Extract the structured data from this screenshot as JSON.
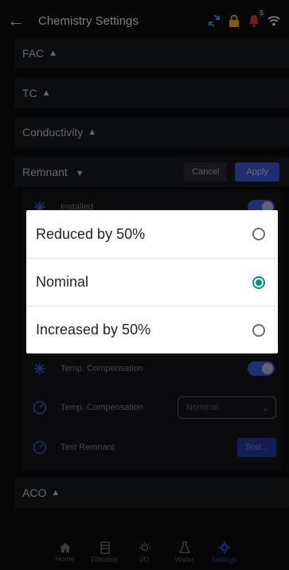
{
  "header": {
    "title": "Chemistry Settings",
    "notification_count": "5"
  },
  "sections": {
    "fac": "FAC",
    "tc": "TC",
    "conductivity": "Conductivity",
    "remnant": "Remnant",
    "aco": "ACO"
  },
  "remnant_actions": {
    "cancel": "Cancel",
    "apply": "Apply"
  },
  "remnant_rows": {
    "installed": "Installed",
    "temp_comp_toggle": "Temp. Compensation",
    "temp_comp_select": "Temp. Compensation",
    "temp_comp_value": "Nominal",
    "test_remnant": "Test Remnant",
    "test_button": "Test..."
  },
  "dialog": {
    "options": [
      {
        "label": "Reduced by 50%",
        "selected": false
      },
      {
        "label": "Nominal",
        "selected": true
      },
      {
        "label": "Increased by 50%",
        "selected": false
      }
    ]
  },
  "nav": [
    {
      "label": "Home",
      "icon": "home-icon"
    },
    {
      "label": "Filtration",
      "icon": "filtration-icon"
    },
    {
      "label": "I/O",
      "icon": "io-icon"
    },
    {
      "label": "Water",
      "icon": "water-icon"
    },
    {
      "label": "Settings",
      "icon": "settings-icon",
      "active": true
    }
  ],
  "colors": {
    "accent": "#3a55c9",
    "radio_selected": "#009476",
    "warning": "#f5a623",
    "alert": "#e0302b"
  }
}
